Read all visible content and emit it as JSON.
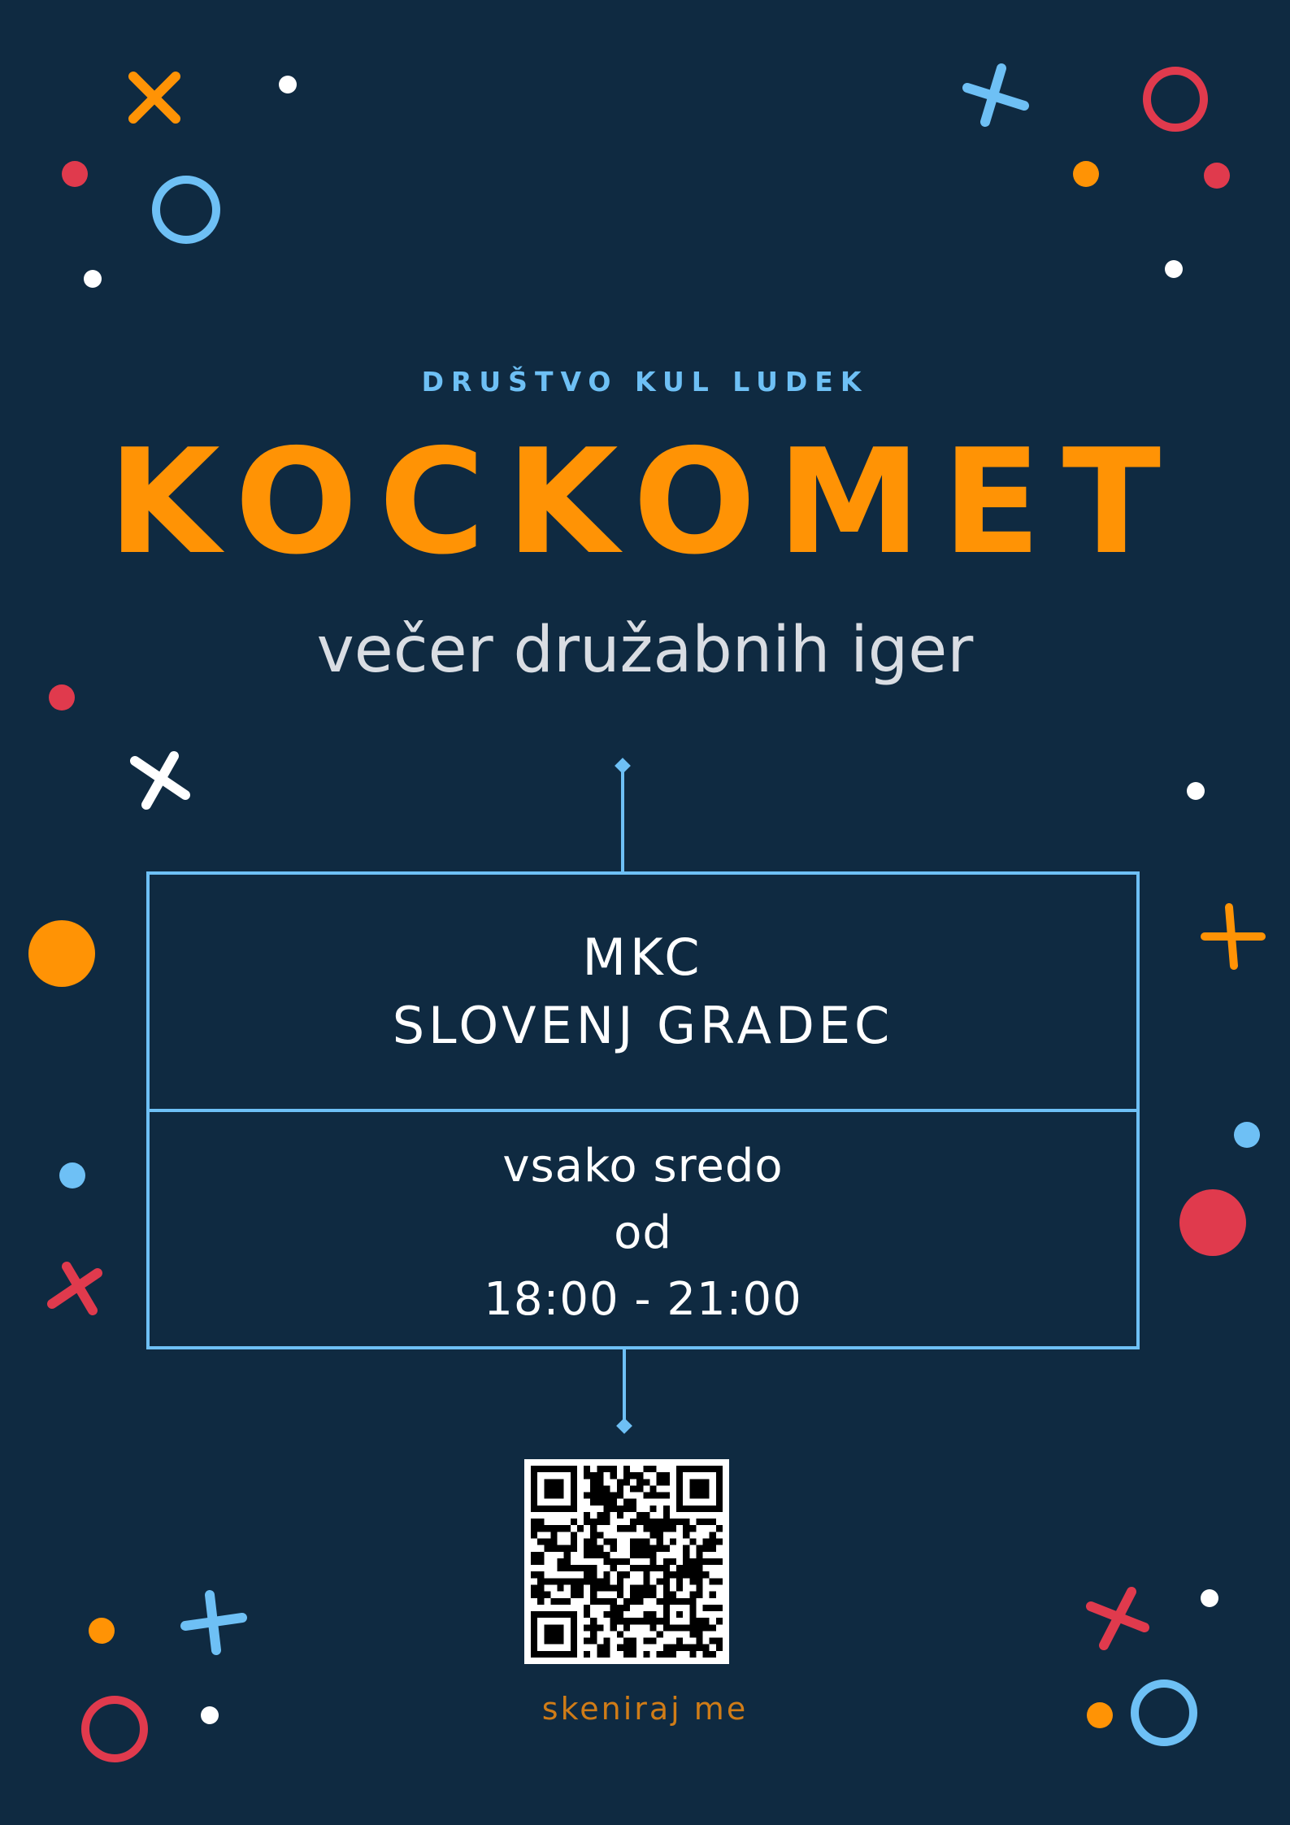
{
  "poster": {
    "organization": "DRUŠTVO KUL LUDEK",
    "title": "KOCKOMET",
    "subtitle": "večer družabnih iger",
    "venue": {
      "line1": "MKC",
      "line2": "SLOVENJ GRADEC"
    },
    "schedule": {
      "line1": "vsako sredo",
      "line2": "od",
      "line3": "18:00 - 21:00"
    },
    "qr_caption": "skeniraj me"
  },
  "colors": {
    "background": "#0f2a41",
    "title": "#ff9305",
    "organization": "#6ec0f5",
    "subtitle": "#d9dde3",
    "frame": "#6ec0f5",
    "caption": "#d07c17",
    "orange": "#ff9305",
    "red": "#e03a4d",
    "blue": "#6ec0f5",
    "white": "#ffffff"
  },
  "icons": {
    "qr": "qr-code-icon",
    "decor_cross": "cross-icon",
    "decor_ring": "ring-icon",
    "decor_dot": "dot-icon"
  }
}
